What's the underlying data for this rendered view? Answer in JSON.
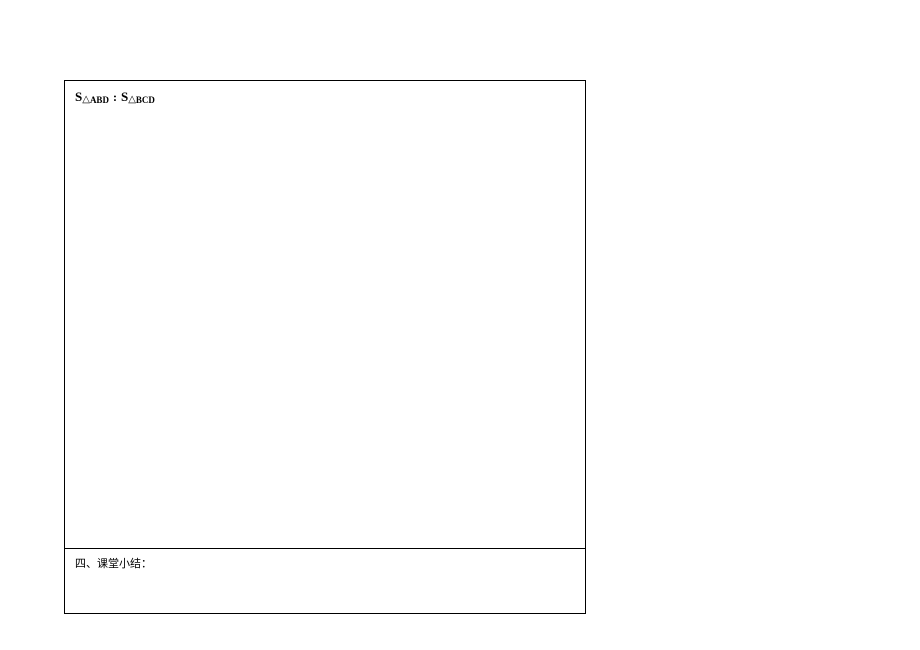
{
  "formula": {
    "s1": "S",
    "tri1": "△",
    "sub1": "ABD",
    "colon": ":",
    "s2": "S",
    "tri2": "△",
    "sub2": "BCD"
  },
  "bottom": {
    "text": "四、课堂小结："
  }
}
